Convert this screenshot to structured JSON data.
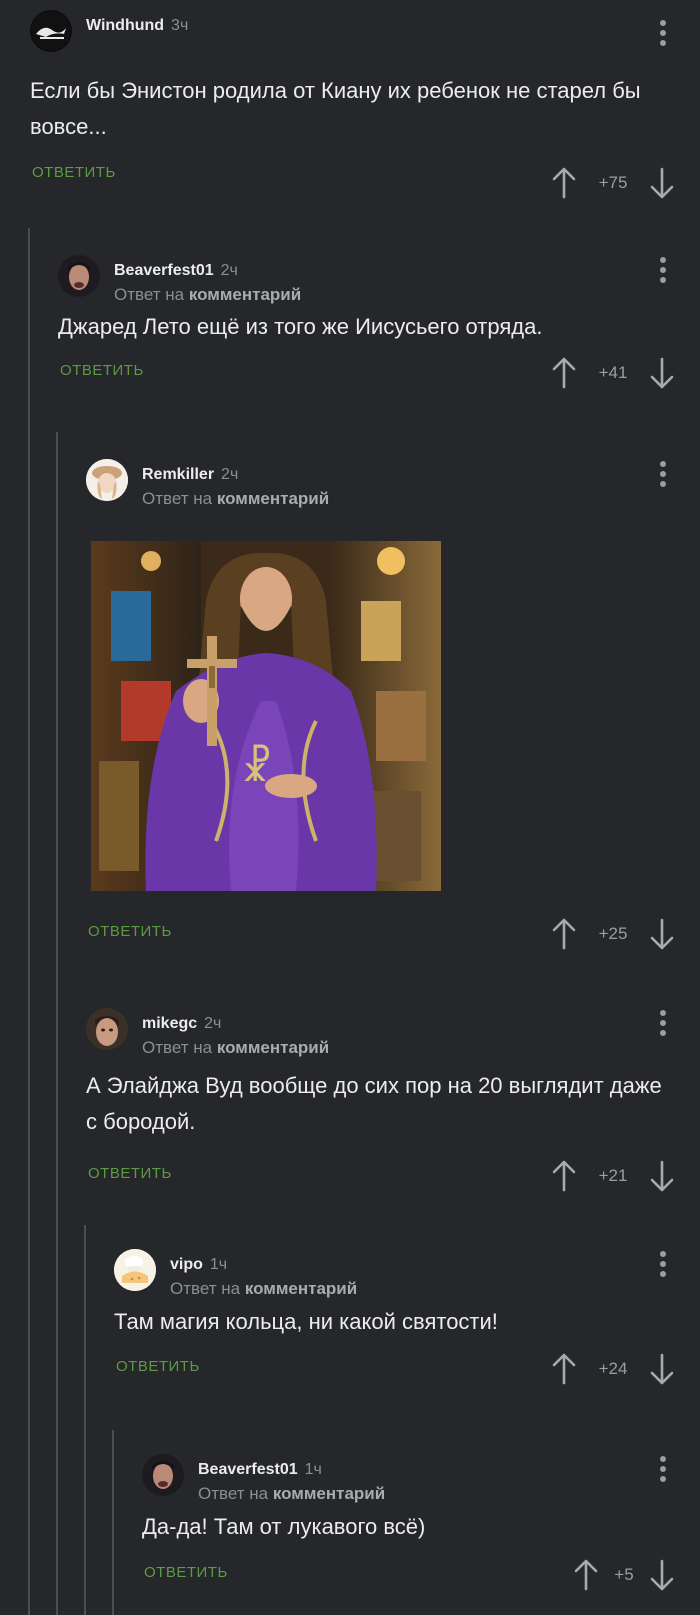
{
  "reply_label": "ОТВЕТИТЬ",
  "reply_prefix": "Ответ на",
  "reply_target": "комментарий",
  "comments": [
    {
      "user": "Windhund",
      "time": "3ч",
      "text": "Если бы Энистон родила от Киану их ребенок не старел бы вовсе...",
      "rating": "+75",
      "is_reply": false
    },
    {
      "user": "Beaverfest01",
      "time": "2ч",
      "text": "Джаред Лето ещё из того же Иисусьего отряда.",
      "rating": "+41",
      "is_reply": true
    },
    {
      "user": "Remkiller",
      "time": "2ч",
      "text": "",
      "rating": "+25",
      "is_reply": true,
      "has_image": true
    },
    {
      "user": "mikegc",
      "time": "2ч",
      "text": "А Элайджа Вуд вообще до сих пор на 20 выглядит даже с бородой.",
      "rating": "+21",
      "is_reply": true
    },
    {
      "user": "vipo",
      "time": "1ч",
      "text": "Там магия кольца, ни какой святости!",
      "rating": "+24",
      "is_reply": true
    },
    {
      "user": "Beaverfest01",
      "time": "1ч",
      "text": "Да-да! Там от лукавого всё)",
      "rating": "+5",
      "is_reply": true
    }
  ],
  "colors": {
    "background": "#25272a",
    "reply_green": "#5d9a45",
    "thread_line": "#4a4d52",
    "muted": "#8b8e93"
  }
}
